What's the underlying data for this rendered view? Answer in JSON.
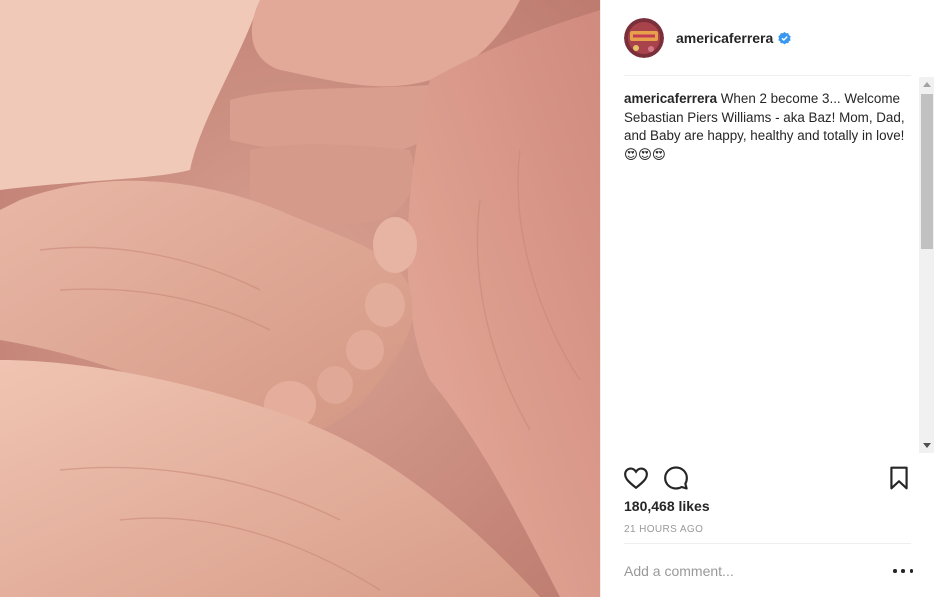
{
  "post": {
    "username": "americaferrera",
    "verified": true,
    "caption_username": "americaferrera",
    "caption_text": "When 2 become 3... Welcome Sebastian Piers Williams - aka Baz! Mom, Dad, and Baby are happy, healthy and totally in love! 😍😍😍",
    "likes": "180,468 likes",
    "time_ago": "21 HOURS AGO"
  },
  "comment_box": {
    "placeholder": "Add a comment..."
  },
  "icons": {
    "like": "heart-icon",
    "comment": "comment-bubble-icon",
    "save": "bookmark-icon",
    "more": "more-options-icon",
    "verified": "verified-badge-icon"
  },
  "colors": {
    "text": "#262626",
    "muted": "#999999",
    "verified": "#3897f0",
    "divider": "#efefef"
  }
}
